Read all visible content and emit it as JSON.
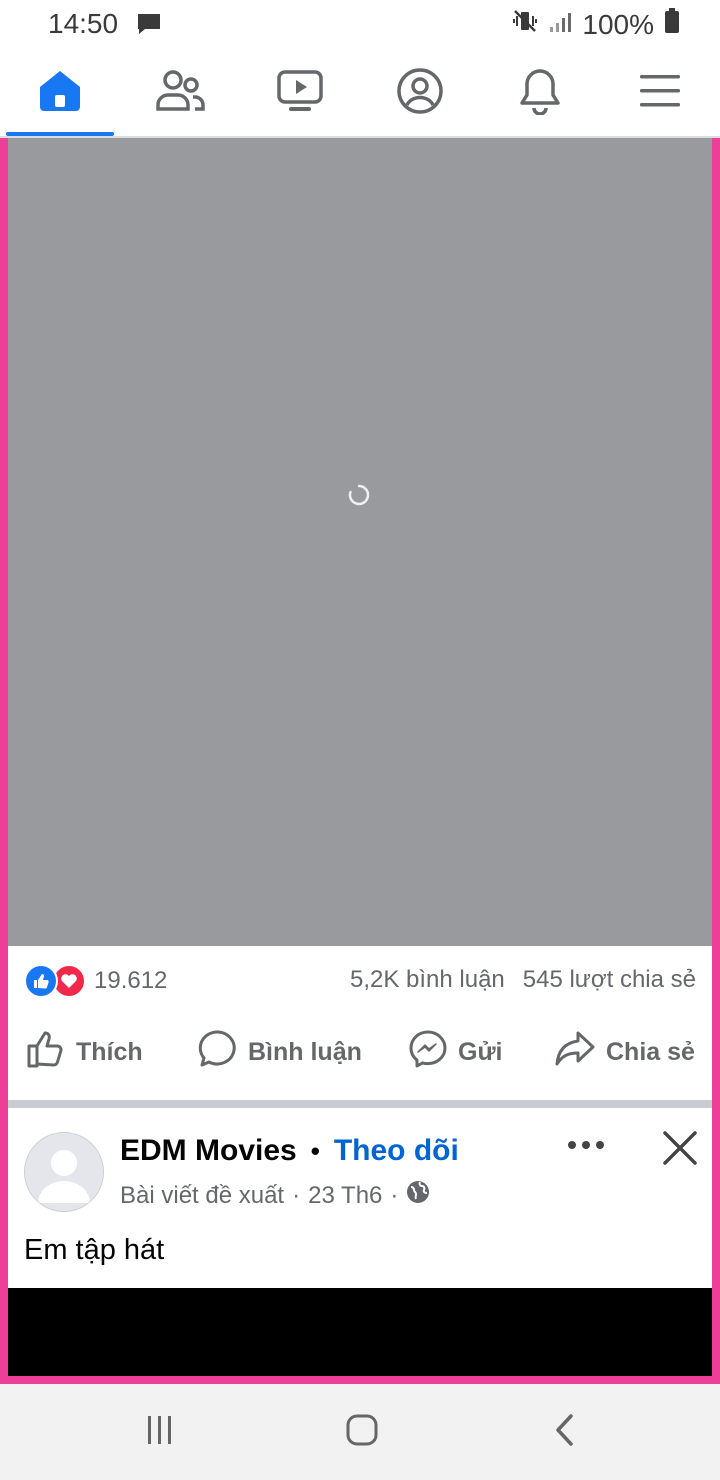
{
  "status_bar": {
    "time": "14:50",
    "battery": "100%"
  },
  "top_nav": {
    "tabs": [
      {
        "name": "home",
        "icon": "home-icon",
        "active": true
      },
      {
        "name": "friends",
        "icon": "friends-icon",
        "active": false
      },
      {
        "name": "watch",
        "icon": "watch-icon",
        "active": false
      },
      {
        "name": "profile",
        "icon": "profile-icon",
        "active": false
      },
      {
        "name": "notifications",
        "icon": "bell-icon",
        "active": false
      },
      {
        "name": "menu",
        "icon": "hamburger-menu-icon",
        "active": false
      }
    ],
    "accent_color": "#1877f2"
  },
  "post_1": {
    "reaction_count": "19.612",
    "comments": "5,2K bình luận",
    "shares": "545 lượt chia sẻ",
    "actions": {
      "like": "Thích",
      "comment": "Bình luận",
      "send": "Gửi",
      "share": "Chia sẻ"
    }
  },
  "post_2": {
    "author": "EDM Movies",
    "separator": "•",
    "follow_label": "Theo dõi",
    "meta_label": "Bài viết đề xuất",
    "meta_sep": "·",
    "date": "23 Th6",
    "meta_sep2": "·",
    "privacy_icon": "globe-icon",
    "caption": "Em tập hát"
  },
  "colors": {
    "highlight_border": "#ed3f97",
    "video_placeholder": "#989a9e",
    "follow_link": "#0064d1"
  }
}
